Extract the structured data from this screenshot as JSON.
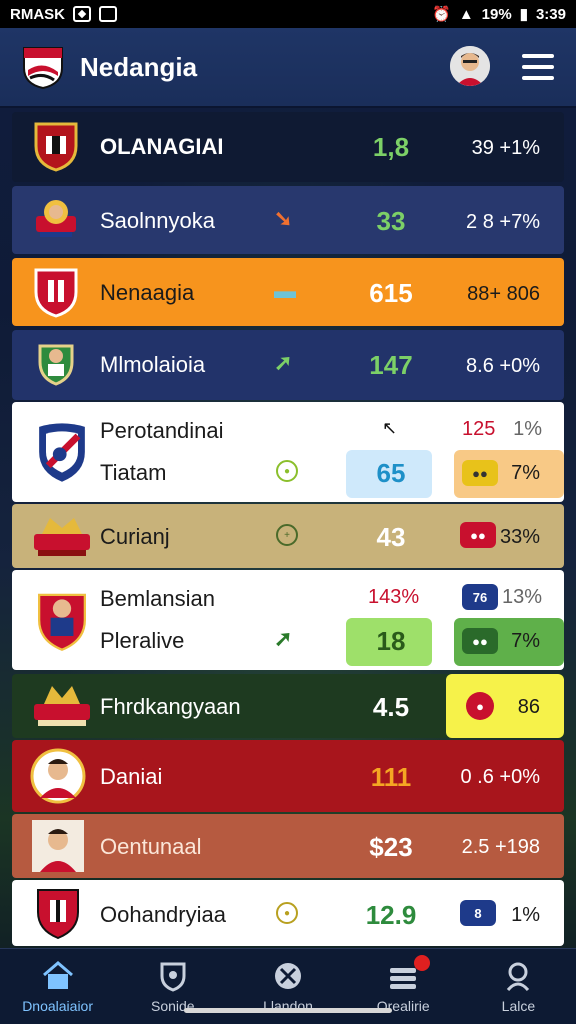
{
  "status_bar": {
    "carrier": "RMASK",
    "battery": "19%",
    "time": "3:39"
  },
  "app": {
    "title": "Nedangia"
  },
  "rows": [
    {
      "name": "OLANAGIAI",
      "value": "1,8",
      "pct": "39 +1%",
      "value_color": "#7cd067"
    },
    {
      "name": "Saolnnyoka",
      "value": "33",
      "pct": "2 8 +7%",
      "value_color": "#7cd067"
    },
    {
      "name": "Nenaagia",
      "value": "615",
      "pct": "88+ 806",
      "value_color": "#ffffff"
    },
    {
      "name": "Mlmolaioia",
      "value": "147",
      "pct": "8.6 +0%",
      "value_color": "#7cd067"
    },
    {
      "name": "Perotandinai",
      "subname": "Tiatam",
      "top_value": "125",
      "top_pct": "1%",
      "value": "65",
      "pct": "7%"
    },
    {
      "name": "Curianj",
      "value": "43",
      "pct": "33%"
    },
    {
      "name": "Bemlansian",
      "subname": "Pleralive",
      "top_value": "143%",
      "top_pct": "13%",
      "value": "18",
      "pct": "7%",
      "badge": "76"
    },
    {
      "name": "Fhrdkangyaan",
      "value": "4.5",
      "pct": "86"
    },
    {
      "name": "Daniai",
      "value": "111",
      "pct": "0 .6 +0%"
    },
    {
      "name": "Oentunaal",
      "value": "$23",
      "pct": "2.5 +198"
    },
    {
      "name": "Oohandryiaa",
      "value": "12.9",
      "pct": "1%",
      "badge": "8"
    }
  ],
  "nav": [
    {
      "label": "Dnoalaiaior",
      "icon": "home-icon"
    },
    {
      "label": "Sonide",
      "icon": "shield-icon"
    },
    {
      "label": "Llandon",
      "icon": "ball-icon"
    },
    {
      "label": "Orealirie",
      "icon": "stack-icon"
    },
    {
      "label": "Lalce",
      "icon": "search-icon"
    }
  ],
  "colors": {
    "accent": "#7fc3ff",
    "up": "#7cd067",
    "down": "#e02020"
  }
}
